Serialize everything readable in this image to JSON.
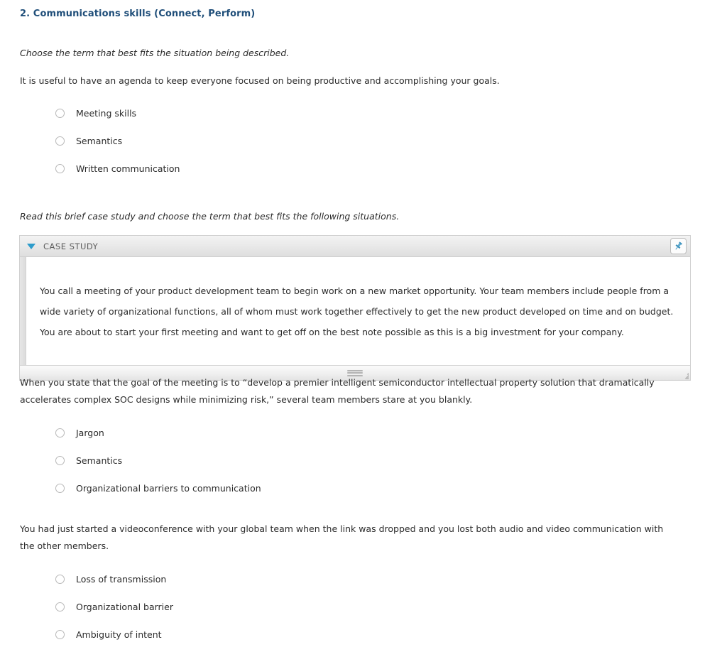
{
  "section": {
    "heading": "2. Communications skills (Connect, Perform)",
    "heading_color": "#1f4e79"
  },
  "instructions": {
    "first": "Choose the term that best fits the situation being described.",
    "second": "Read this brief case study and choose the term that best fits the following situations."
  },
  "questions": [
    {
      "prompt": "It is useful to have an agenda to keep everyone focused on being productive and accomplishing your goals.",
      "options": [
        "Meeting skills",
        "Semantics",
        "Written communication"
      ]
    },
    {
      "prompt": "When you state that the goal of the meeting is to “develop a premier intelligent semiconductor intellectual property solution that dramatically accelerates complex SOC designs while minimizing risk,” several team members stare at you blankly.",
      "options": [
        "Jargon",
        "Semantics",
        "Organizational barriers to communication"
      ]
    },
    {
      "prompt": "You had just started a videoconference with your global team when the link was dropped and you lost both audio and video communication with the other members.",
      "options": [
        "Loss of transmission",
        "Organizational barrier",
        "Ambiguity of intent"
      ]
    }
  ],
  "case_study": {
    "title": "CASE STUDY",
    "caret_icon": "triangle-down-icon",
    "caret_color": "#2e9ccb",
    "pin_icon": "pushpin-icon",
    "pin_color": "#3a91bd",
    "grip_icon": "drag-handle-icon",
    "resize_icon": "resize-grip-icon",
    "body": "You call a meeting of your product development team to begin work on a new market opportunity. Your team members include people from a wide variety of organizational functions, all of whom must work together effectively to get the new product developed on time and on budget. You are about to start your first meeting and want to get off on the best note possible as this is a big investment for your company."
  }
}
